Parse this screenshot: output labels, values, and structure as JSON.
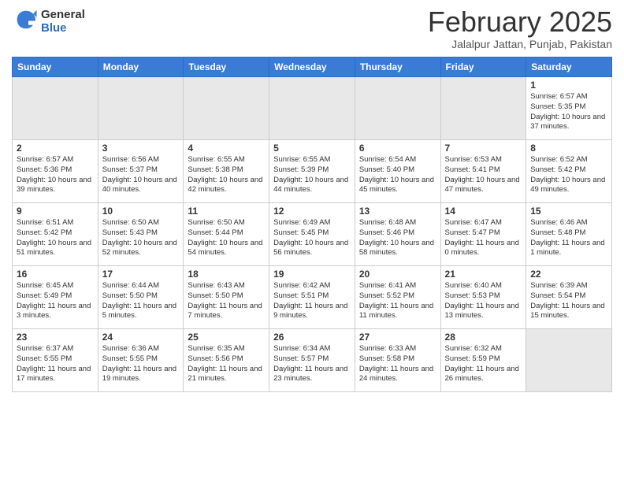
{
  "header": {
    "logo_general": "General",
    "logo_blue": "Blue",
    "month_year": "February 2025",
    "location": "Jalalpur Jattan, Punjab, Pakistan"
  },
  "days_of_week": [
    "Sunday",
    "Monday",
    "Tuesday",
    "Wednesday",
    "Thursday",
    "Friday",
    "Saturday"
  ],
  "weeks": [
    {
      "days": [
        {
          "date": "",
          "empty": true
        },
        {
          "date": "",
          "empty": true
        },
        {
          "date": "",
          "empty": true
        },
        {
          "date": "",
          "empty": true
        },
        {
          "date": "",
          "empty": true
        },
        {
          "date": "",
          "empty": true
        },
        {
          "date": "1",
          "sunrise": "6:57 AM",
          "sunset": "5:35 PM",
          "daylight": "10 hours and 37 minutes."
        }
      ]
    },
    {
      "days": [
        {
          "date": "2",
          "sunrise": "6:57 AM",
          "sunset": "5:36 PM",
          "daylight": "10 hours and 39 minutes."
        },
        {
          "date": "3",
          "sunrise": "6:56 AM",
          "sunset": "5:37 PM",
          "daylight": "10 hours and 40 minutes."
        },
        {
          "date": "4",
          "sunrise": "6:55 AM",
          "sunset": "5:38 PM",
          "daylight": "10 hours and 42 minutes."
        },
        {
          "date": "5",
          "sunrise": "6:55 AM",
          "sunset": "5:39 PM",
          "daylight": "10 hours and 44 minutes."
        },
        {
          "date": "6",
          "sunrise": "6:54 AM",
          "sunset": "5:40 PM",
          "daylight": "10 hours and 45 minutes."
        },
        {
          "date": "7",
          "sunrise": "6:53 AM",
          "sunset": "5:41 PM",
          "daylight": "10 hours and 47 minutes."
        },
        {
          "date": "8",
          "sunrise": "6:52 AM",
          "sunset": "5:42 PM",
          "daylight": "10 hours and 49 minutes."
        }
      ]
    },
    {
      "days": [
        {
          "date": "9",
          "sunrise": "6:51 AM",
          "sunset": "5:42 PM",
          "daylight": "10 hours and 51 minutes."
        },
        {
          "date": "10",
          "sunrise": "6:50 AM",
          "sunset": "5:43 PM",
          "daylight": "10 hours and 52 minutes."
        },
        {
          "date": "11",
          "sunrise": "6:50 AM",
          "sunset": "5:44 PM",
          "daylight": "10 hours and 54 minutes."
        },
        {
          "date": "12",
          "sunrise": "6:49 AM",
          "sunset": "5:45 PM",
          "daylight": "10 hours and 56 minutes."
        },
        {
          "date": "13",
          "sunrise": "6:48 AM",
          "sunset": "5:46 PM",
          "daylight": "10 hours and 58 minutes."
        },
        {
          "date": "14",
          "sunrise": "6:47 AM",
          "sunset": "5:47 PM",
          "daylight": "11 hours and 0 minutes."
        },
        {
          "date": "15",
          "sunrise": "6:46 AM",
          "sunset": "5:48 PM",
          "daylight": "11 hours and 1 minute."
        }
      ]
    },
    {
      "days": [
        {
          "date": "16",
          "sunrise": "6:45 AM",
          "sunset": "5:49 PM",
          "daylight": "11 hours and 3 minutes."
        },
        {
          "date": "17",
          "sunrise": "6:44 AM",
          "sunset": "5:50 PM",
          "daylight": "11 hours and 5 minutes."
        },
        {
          "date": "18",
          "sunrise": "6:43 AM",
          "sunset": "5:50 PM",
          "daylight": "11 hours and 7 minutes."
        },
        {
          "date": "19",
          "sunrise": "6:42 AM",
          "sunset": "5:51 PM",
          "daylight": "11 hours and 9 minutes."
        },
        {
          "date": "20",
          "sunrise": "6:41 AM",
          "sunset": "5:52 PM",
          "daylight": "11 hours and 11 minutes."
        },
        {
          "date": "21",
          "sunrise": "6:40 AM",
          "sunset": "5:53 PM",
          "daylight": "11 hours and 13 minutes."
        },
        {
          "date": "22",
          "sunrise": "6:39 AM",
          "sunset": "5:54 PM",
          "daylight": "11 hours and 15 minutes."
        }
      ]
    },
    {
      "days": [
        {
          "date": "23",
          "sunrise": "6:37 AM",
          "sunset": "5:55 PM",
          "daylight": "11 hours and 17 minutes."
        },
        {
          "date": "24",
          "sunrise": "6:36 AM",
          "sunset": "5:55 PM",
          "daylight": "11 hours and 19 minutes."
        },
        {
          "date": "25",
          "sunrise": "6:35 AM",
          "sunset": "5:56 PM",
          "daylight": "11 hours and 21 minutes."
        },
        {
          "date": "26",
          "sunrise": "6:34 AM",
          "sunset": "5:57 PM",
          "daylight": "11 hours and 23 minutes."
        },
        {
          "date": "27",
          "sunrise": "6:33 AM",
          "sunset": "5:58 PM",
          "daylight": "11 hours and 24 minutes."
        },
        {
          "date": "28",
          "sunrise": "6:32 AM",
          "sunset": "5:59 PM",
          "daylight": "11 hours and 26 minutes."
        },
        {
          "date": "",
          "empty": true
        }
      ]
    }
  ]
}
